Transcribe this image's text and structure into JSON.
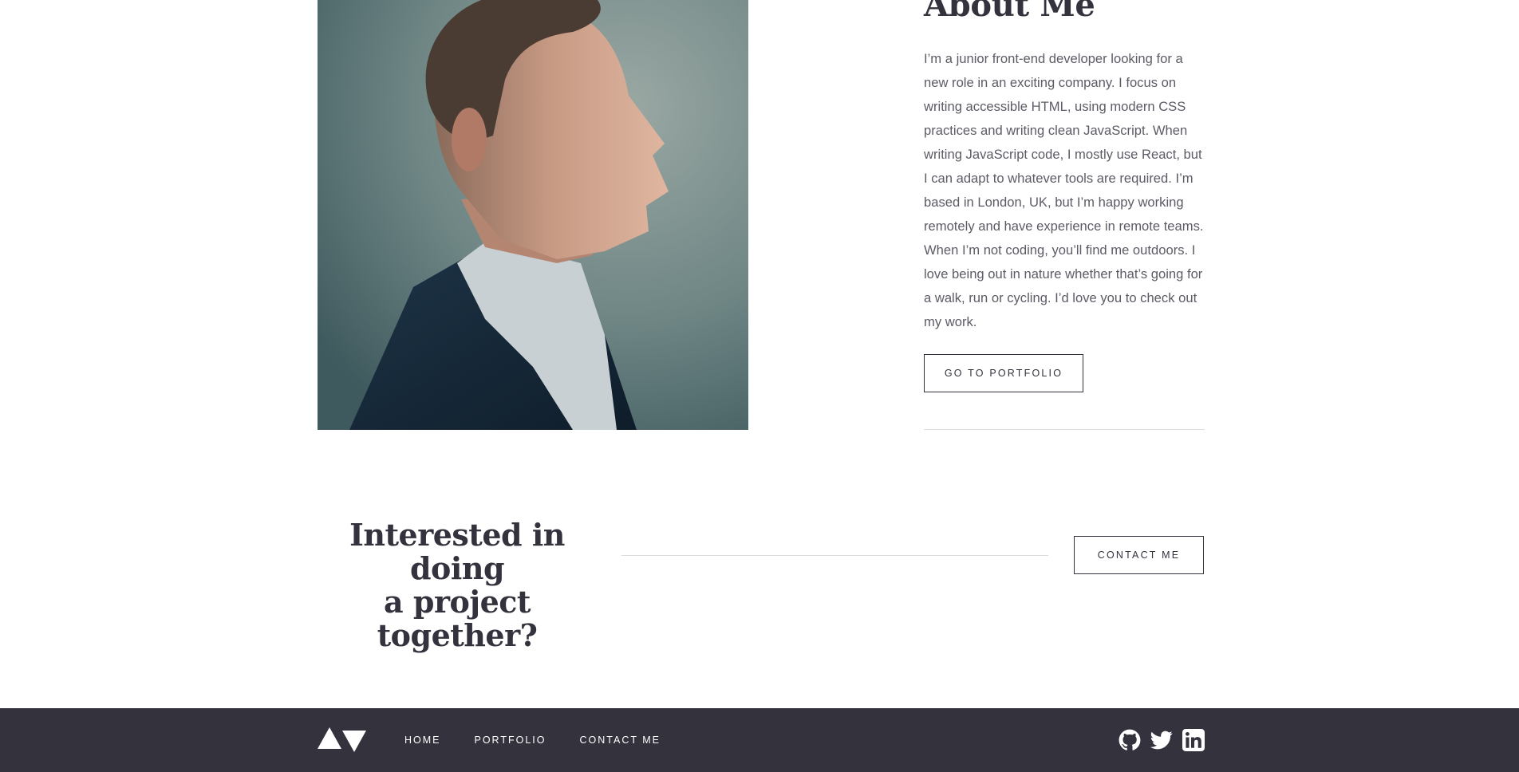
{
  "about": {
    "heading": "About Me",
    "paragraph": "I’m a junior front-end developer looking for a new role in an exciting company. I focus on writing accessible HTML, using modern CSS practices and writing clean JavaScript. When writing JavaScript code, I mostly use React, but I can adapt to whatever tools are required. I’m based in London, UK, but I’m happy working remotely and have experience in remote teams. When I’m not coding, you’ll find me outdoors. I love being out in nature whether that’s going for a walk, run or cycling. I’d love you to check out my work.",
    "button_label": "GO TO PORTFOLIO"
  },
  "cta": {
    "heading_line1": "Interested in doing",
    "heading_line2": "a project together?",
    "button_label": "CONTACT ME"
  },
  "footer": {
    "nav": [
      "HOME",
      "PORTFOLIO",
      "CONTACT ME"
    ],
    "socials": [
      "github-icon",
      "twitter-icon",
      "linkedin-icon"
    ]
  },
  "colors": {
    "dark": "#33323d",
    "body_text": "#5c5b66",
    "rule": "#dcdcdf",
    "background": "#ffffff"
  }
}
